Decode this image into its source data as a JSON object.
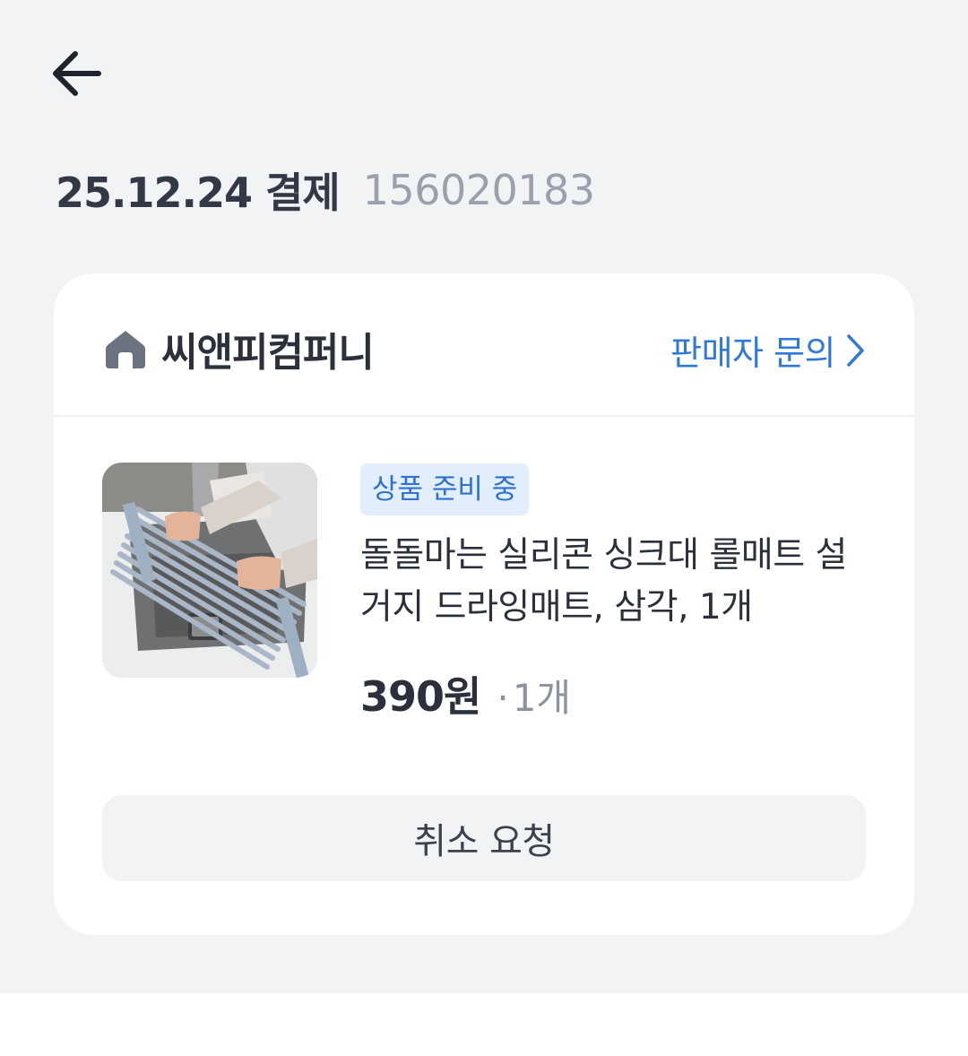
{
  "header": {
    "back_icon": "arrow-left-icon"
  },
  "order": {
    "date_label": "25.12.24 결제",
    "order_number": "156020183"
  },
  "seller": {
    "icon": "home-icon",
    "name": "씨앤피컴퍼니",
    "inquiry_label": "판매자 문의",
    "inquiry_icon": "chevron-right-icon"
  },
  "product": {
    "status": "상품 준비 중",
    "name": "돌돌마는 실리콘 싱크대 롤매트 설거지 드라잉매트, 삼각, 1개",
    "price": "390원",
    "quantity": "1개",
    "thumbnail": "product-thumbnail"
  },
  "actions": {
    "cancel_label": "취소 요청"
  },
  "colors": {
    "background": "#f2f3f5",
    "card": "#ffffff",
    "link": "#2f7ad8",
    "badge_bg": "#e3eefc",
    "badge_text": "#2f72cf",
    "muted": "#9aa1ad"
  }
}
